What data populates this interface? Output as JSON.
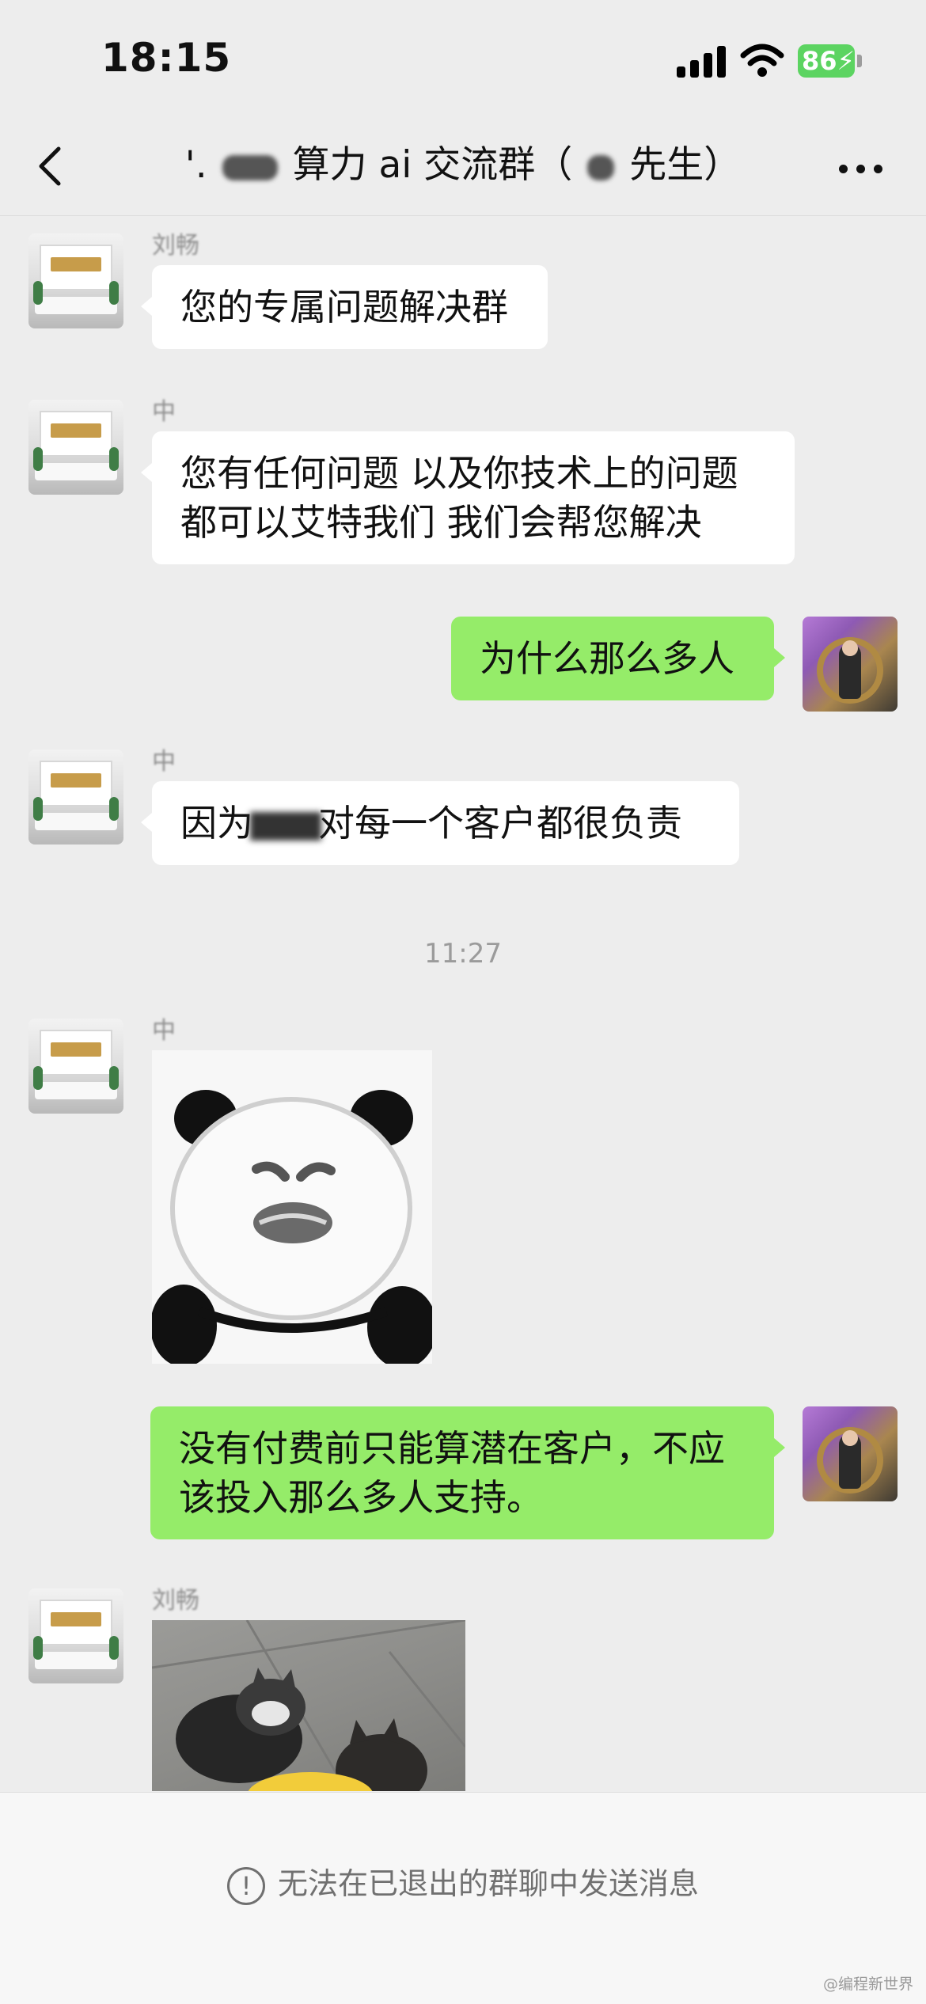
{
  "status_bar": {
    "time": "18:15",
    "battery_level": "86",
    "battery_color": "#5cd461"
  },
  "nav": {
    "title_prefix": "'.",
    "title_suffix": "算力 ai 交流群（",
    "title_end": "先生）",
    "back_icon": "chevron-left-icon",
    "more_icon": "more-dots-icon"
  },
  "messages": [
    {
      "side": "left",
      "sender": "刘畅",
      "text": "您的专属问题解决群"
    },
    {
      "side": "left",
      "sender": "中",
      "text_line1": "您有任何问题 以及你技术上的问题",
      "text_line2": "都可以艾特我们  我们会帮您解决"
    },
    {
      "side": "right",
      "text": "为什么那么多人"
    },
    {
      "side": "left",
      "sender": "中",
      "text_before": "因为",
      "text_after": "对每一个客户都很负责"
    },
    {
      "side": "left",
      "sender": "中",
      "sticker": "panda-meme-sticker"
    },
    {
      "side": "right",
      "text_line1": "没有付费前只能算潜在客户，不应",
      "text_line2": "该投入那么多人支持。"
    },
    {
      "side": "left",
      "sender": "刘畅",
      "sticker": "kittens-photo"
    }
  ],
  "time_divider": "11:27",
  "bottom": {
    "notice": "无法在已退出的群聊中发送消息",
    "notice_icon": "exclamation-circle-icon",
    "watermark": "@编程新世界"
  },
  "colors": {
    "background": "#ededed",
    "my_bubble": "#95ec69",
    "their_bubble": "#ffffff"
  }
}
